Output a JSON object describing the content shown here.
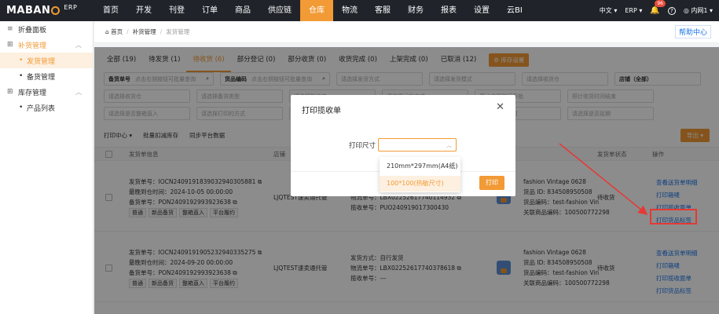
{
  "app": {
    "logo_text_1": "MABAN",
    "logo_text_2": "G",
    "logo_suffix": "ERP"
  },
  "nav": {
    "items": [
      "首页",
      "开发",
      "刊登",
      "订单",
      "商品",
      "供应链",
      "仓库",
      "物流",
      "客服",
      "财务",
      "报表",
      "设置",
      "云BI"
    ],
    "active": "仓库"
  },
  "topright": {
    "lang": "中文",
    "erp": "ERP",
    "badge": "96",
    "user": "内网1"
  },
  "sidebar": {
    "collapse": "折叠面板",
    "groups": [
      {
        "label": "补货管理",
        "open": true,
        "items": [
          {
            "label": "发货管理",
            "active": true
          },
          {
            "label": "备货管理",
            "active": false
          }
        ]
      },
      {
        "label": "库存管理",
        "open": false,
        "items": [
          {
            "label": "产品列表",
            "active": false
          }
        ]
      }
    ]
  },
  "breadcrumb": {
    "home": "首页",
    "level1": "补货管理",
    "level2": "发货管理",
    "help": "帮助中心"
  },
  "tabs": {
    "items": [
      "全部 (19)",
      "待发货 (1)",
      "待收货 (6)",
      "部分登记 (0)",
      "部分收货 (0)",
      "收货完成 (0)",
      "上架完成 (0)",
      "已取消 (12)"
    ],
    "active": "待收货 (6)",
    "settings": "库存设置"
  },
  "filters": {
    "row1": [
      {
        "label": "备货单号",
        "placeholder": "点击右侧按钮可批量查询"
      },
      {
        "label": "货品编码",
        "placeholder": "点击右侧按钮可批量查询"
      },
      {
        "label": "",
        "placeholder": "请选择发货方式"
      },
      {
        "label": "",
        "placeholder": "请选择发货模式"
      },
      {
        "label": "",
        "placeholder": "请选择收货仓"
      },
      {
        "label": "店铺（全部）",
        "placeholder": ""
      }
    ],
    "row2": [
      {
        "placeholder": "请选择收货仓"
      },
      {
        "placeholder": "请选择备货类型"
      },
      {
        "placeholder": "请选择物流商"
      },
      {
        "placeholder": "请选择运输方式"
      },
      {
        "placeholder": "预计收货时间开始"
      },
      {
        "placeholder": "预计收货时间结束"
      }
    ],
    "row3": [
      {
        "placeholder": "请选择是否整箱直入"
      },
      {
        "placeholder": "请选择打印的方式"
      },
      {
        "placeholder": "请选择打印状态"
      },
      {
        "placeholder": "请选择是否加急"
      },
      {
        "placeholder": "请选择是否超时"
      },
      {
        "placeholder": "请选择是否延期"
      }
    ]
  },
  "toolbar": {
    "print_center": "打印中心",
    "batch_deduct": "批量扣减库存",
    "sync": "同步平台数据",
    "export": "导出"
  },
  "table": {
    "headers": {
      "info": "发货单信息",
      "shop": "店铺",
      "status": "发货单状态",
      "ops": "操作"
    },
    "orders": [
      {
        "order_no_label": "发货单号：",
        "order_no": "IOCN240919183903294030​5881",
        "arrive_label": "最晚到仓时间：",
        "arrive": "2024-10-05 00:00:00",
        "stock_label": "备货单号：",
        "stock_no": "PON240919299392​3638",
        "tags": [
          "普通",
          "新品备货",
          "整箱直入",
          "平台履约"
        ],
        "shop": "LJQTEST速卖通托管",
        "ship_mode_label": "发货方式：",
        "ship_mode": "揽收发货",
        "tracking_label": "物流单号：",
        "tracking": "LBX022526177401​14932",
        "pickup_label": "揽收单号：",
        "pickup": "PUO240919017300430",
        "product": "fashion Vintage 0628",
        "sku_label": "货品 ID: ",
        "sku": "834508950508",
        "code_label": "货品编码：",
        "code": "test-fashion Vin",
        "spu_label": "关联商品编码：",
        "spu": "100500772298",
        "status": "待收货",
        "ops": [
          "查看送货单明细",
          "打印箱唛",
          "打印揽收面单",
          "打印货品标签"
        ]
      },
      {
        "order_no_label": "发货单号：",
        "order_no": "IOCN240919190523294033​5275",
        "arrive_label": "最晚到仓时间：",
        "arrive": "2024-09-20 00:00:00",
        "stock_label": "备货单号：",
        "stock_no": "PON240919299392​3638",
        "tags": [
          "普通",
          "新品备货",
          "整箱直入",
          "平台履约"
        ],
        "shop": "LJQTEST速卖通托管",
        "ship_mode_label": "发货方式：",
        "ship_mode": "自行发货",
        "tracking_label": "物流单号：",
        "tracking": "LBX022526177403​78618",
        "pickup_label": "揽收单号：",
        "pickup": "---",
        "product": "fashion Vintage 0628",
        "sku_label": "货品 ID: ",
        "sku": "834508950508",
        "code_label": "货品编码：",
        "code": "test-fashion Vin",
        "spu_label": "关联商品编码：",
        "spu": "100500772298",
        "status": "待收货",
        "ops": [
          "查看送货单明细",
          "打印箱唛",
          "打印揽收面单",
          "打印货品标签"
        ]
      }
    ]
  },
  "modal": {
    "title": "打印揽收单",
    "size_label": "打印尺寸",
    "size_placeholder": "",
    "options": [
      "210mm*297mm(A4纸)",
      "100*100(热敏尺寸)"
    ],
    "selected": "100*100(热敏尺寸)",
    "cancel": "消",
    "print": "打印"
  },
  "colors": {
    "accent": "#f29a35",
    "nav_bg": "#20232a",
    "link": "#1a73e8",
    "annotation": "#e53935"
  }
}
